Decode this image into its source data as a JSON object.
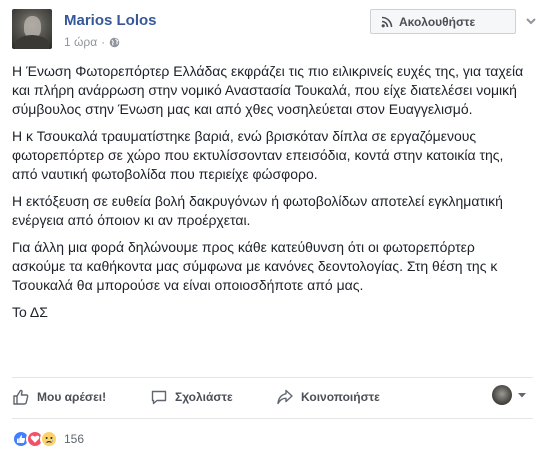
{
  "post": {
    "author": "Marios Lolos",
    "timestamp": "1 ώρα",
    "privacy_icon": "globe-icon",
    "follow_label": "Ακολουθήστε",
    "paragraphs": [
      "Η Ένωση Φωτορεπόρτερ Ελλάδας εκφράζει τις πιο ειλικρινείς ευχές της, για ταχεία και πλήρη ανάρρωση στην νομικό Αναστασία Τουκαλά, που είχε διατελέσει νομική σύμβουλος στην Ένωση μας και από χθες νοσηλεύεται στον Ευαγγελισμό.",
      "Η κ Τσουκαλά τραυματίστηκε βαριά, ενώ βρισκόταν δίπλα σε εργαζόμενους φωτορεπόρτερ σε χώρο που εκτυλίσσονταν επεισόδια, κοντά στην κατοικία της, από ναυτική φωτοβολίδα που περιείχε φώσφορο.",
      "Η εκτόξευση σε ευθεία βολή δακρυγόνων ή φωτοβολίδων αποτελεί εγκληματική ενέργεια από όποιον κι αν προέρχεται.",
      "Για άλλη μια φορά δηλώνουμε προς κάθε κατεύθυνση ότι οι φωτορεπόρτερ ασκούμε τα καθήκοντα μας σύμφωνα με κανόνες δεοντολογίας. Στη θέση της κ Τσουκαλά θα μπορούσε να είναι οποιοσδήποτε από μας.",
      "Το ΔΣ"
    ]
  },
  "actions": {
    "like_label": "Μου αρέσει!",
    "comment_label": "Σχολιάστε",
    "share_label": "Κοινοποιήστε"
  },
  "reactions": {
    "types": [
      "like",
      "love",
      "sad"
    ],
    "count": "156"
  },
  "colors": {
    "link": "#365899",
    "action_text": "#4b4f56",
    "secondary_text": "#90949c",
    "like_blue": "#4080ff",
    "love_red": "#f25268",
    "sad_yellow": "#fcd36a"
  }
}
